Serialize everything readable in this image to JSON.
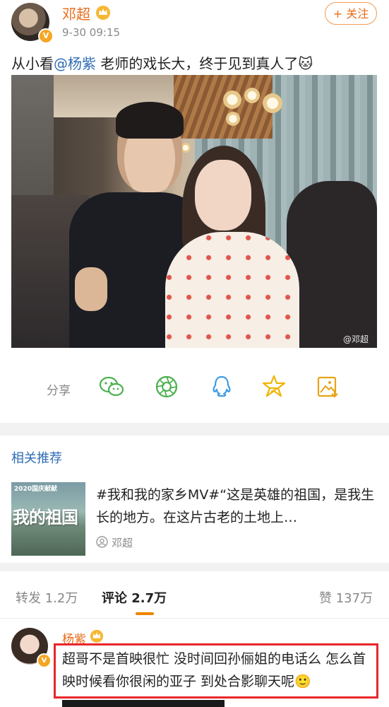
{
  "post": {
    "author": "邓超",
    "time": "9-30 09:15",
    "follow_label": "+ 关注",
    "text_before": "从小看",
    "mention": "@杨紫",
    "text_after": " 老师的戏长大，终于见到真人了",
    "emoji": "🐱",
    "watermark": "@邓超"
  },
  "share": {
    "label": "分享",
    "icons": [
      "wechat-icon",
      "moments-icon",
      "qq-icon",
      "qzone-star-icon",
      "save-image-icon"
    ]
  },
  "related": {
    "title": "相关推荐",
    "thumb_tag": "2020国庆献献",
    "thumb_big": "我的祖国",
    "text": "#我和我的家乡MV#“这是英雄的祖国，是我生长的地方。在这片古老的土地上…",
    "source": "邓超"
  },
  "tabs": [
    {
      "label": "转发 1.2万"
    },
    {
      "label": "评论 2.7万"
    },
    {
      "label": "赞 137万"
    }
  ],
  "comment": {
    "author": "杨紫",
    "text": "超哥不是首映很忙 没时间回孙俪姐的电话么 怎么首映时候看你很闲的亚子 到处合影聊天呢",
    "emoji": "🙂"
  },
  "colors": {
    "accent_orange": "#e86b1a",
    "link_blue": "#2f6db5",
    "highlight_red": "#e8262a"
  }
}
